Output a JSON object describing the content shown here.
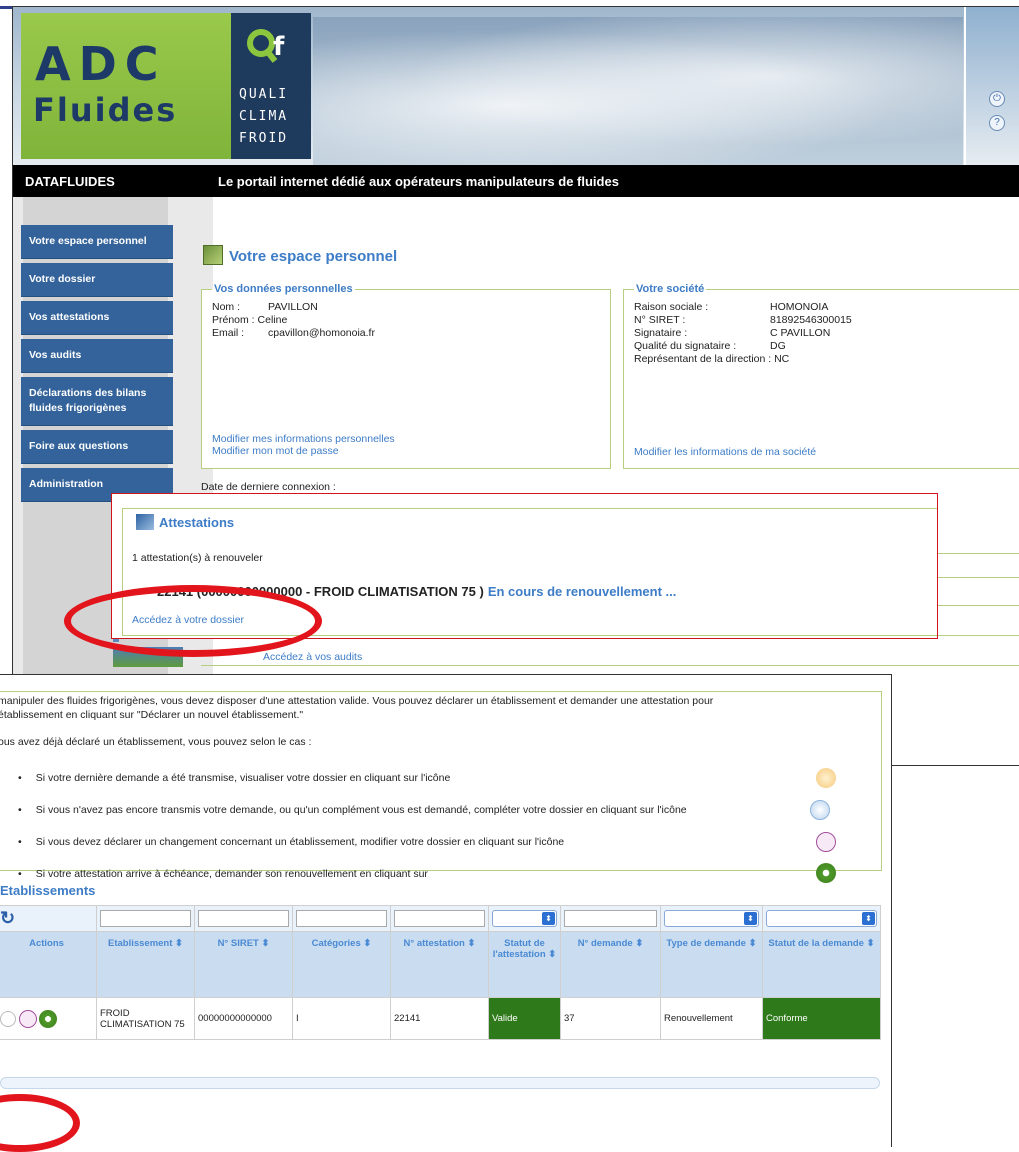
{
  "header": {
    "logo_adc": "ADC",
    "logo_fluides": "Fluides",
    "qcf_line1": "QUALI",
    "qcf_line2": "CLIMA",
    "qcf_line3": "FROID"
  },
  "titlebar": {
    "brand": "DATAFLUIDES",
    "tagline": "Le portail internet dédié aux opérateurs manipulateurs de fluides"
  },
  "nav": {
    "items": [
      {
        "label": "Votre espace personnel"
      },
      {
        "label": "Votre dossier"
      },
      {
        "label": "Vos attestations"
      },
      {
        "label": "Vos audits"
      },
      {
        "label": "Déclarations des bilans fluides frigorigènes"
      },
      {
        "label": "Foire aux questions"
      },
      {
        "label": "Administration"
      }
    ]
  },
  "main": {
    "title": "Votre espace personnel",
    "personal": {
      "legend": "Vos données personnelles",
      "rows": [
        {
          "label": "Nom :",
          "value": "PAVILLON"
        },
        {
          "label": "Prénom :",
          "value": "Celine"
        },
        {
          "label": "Email :",
          "value": "cpavillon@homonoia.fr"
        }
      ],
      "link_info": "Modifier mes informations personnelles",
      "link_pwd": "Modifier mon mot de passe"
    },
    "company": {
      "legend": "Votre société",
      "rows": [
        {
          "label": "Raison sociale :",
          "value": "HOMONOIA"
        },
        {
          "label": "N° SIRET :",
          "value": "81892546300015"
        },
        {
          "label": "Signataire :",
          "value": "C PAVILLON"
        },
        {
          "label": "Qualité du signataire :",
          "value": "DG"
        }
      ],
      "rep_row": "Représentant de la direction : NC",
      "link": "Modifier les informations de ma société"
    },
    "last_login": "Date de derniere connexion :",
    "attestations": {
      "title": "Attestations",
      "count_text": "1 attestation(s) à renouveler",
      "line_text": "22141 (00000000000000 - FROID CLIMATISATION 75 )",
      "line_status": "En cours de renouvellement ...",
      "link": "Accédez à votre dossier"
    },
    "audits_link": "Accédez à vos audits"
  },
  "dossier": {
    "intro": "manipuler des fluides frigorigènes, vous devez disposer d'une attestation valide. Vous pouvez déclarer un établissement et demander une attestation pour",
    "intro2": "établissement en cliquant sur \"Déclarer un nouvel établissement.\"",
    "cases_intro": "ous avez déjà déclaré un établissement, vous pouvez selon le cas :",
    "bullets": [
      {
        "text": "Si votre dernière demande a été transmise, visualiser votre dossier en cliquant sur l'icône"
      },
      {
        "text": "Si vous n'avez pas encore transmis votre demande, ou qu'un complément vous est demandé, compléter votre dossier en cliquant sur l'icône"
      },
      {
        "text": "Si vous devez déclarer un changement concernant un établissement, modifier votre dossier en cliquant sur l'icône"
      },
      {
        "text": "Si votre attestation arrive à échéance, demander son renouvellement en cliquant sur"
      }
    ],
    "section_title": "Etablissements",
    "table": {
      "headers": [
        "Actions",
        "Etablissement ⬍",
        "N° SIRET ⬍",
        "Catégories ⬍",
        "N° attestation ⬍",
        "Statut de l'attestation ⬍",
        "N° demande ⬍",
        "Type de demande ⬍",
        "Statut de la demande ⬍"
      ],
      "row": {
        "etablissement": "FROID CLIMATISATION 75",
        "siret": "00000000000000",
        "categories": "I",
        "attestation": "22141",
        "statut_attestation": "Valide",
        "demande": "37",
        "type_demande": "Renouvellement",
        "statut_demande": "Conforme"
      }
    }
  },
  "colors": {
    "nav_blue": "#33639a",
    "link_blue": "#3d7cc6",
    "highlight_red": "#e3151c",
    "status_green": "#2e7a1a"
  }
}
